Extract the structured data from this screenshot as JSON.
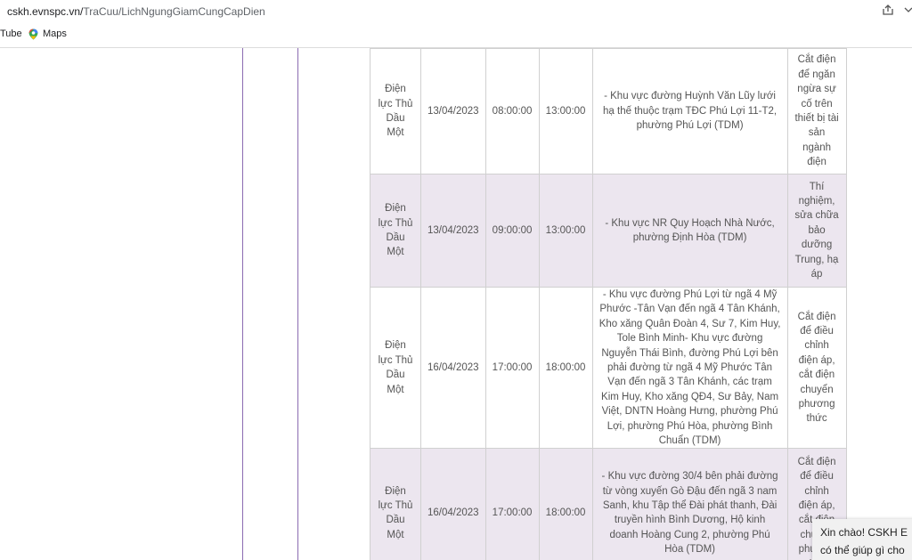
{
  "browser": {
    "url_host": "cskh.evnspc.vn/",
    "url_path": "TraCuu/LichNgungGiamCungCapDien",
    "share_icon": "share-icon",
    "menu_icon": "chevron-icon",
    "bookmarks": [
      {
        "label": "Tube",
        "icon": "youtube-icon"
      },
      {
        "label": "Maps",
        "icon": "maps-icon"
      }
    ]
  },
  "colors": {
    "accent_line": "#8b6bb1",
    "row_alt": "#ece6ef"
  },
  "schedule": {
    "rows": [
      {
        "unit": "Điện lực Thủ Dầu Một",
        "date": "13/04/2023",
        "from": "08:00:00",
        "to": "13:00:00",
        "area": "- Khu vực đường Huỳnh Văn Lũy lưới hạ thế thuộc trạm TĐC Phú Lợi 11-T2, phường Phú Lợi (TDM)",
        "reason": "Cắt điện để ngăn ngừa sự cố trên thiết bị tài sản ngành điện"
      },
      {
        "unit": "Điện lực Thủ Dầu Một",
        "date": "13/04/2023",
        "from": "09:00:00",
        "to": "13:00:00",
        "area": "- Khu vực NR Quy Hoạch Nhà Nước, phường Định Hòa (TDM)",
        "reason": "Thí nghiệm, sửa chữa bảo dưỡng Trung, hạ áp"
      },
      {
        "unit": "Điện lực Thủ Dầu Một",
        "date": "16/04/2023",
        "from": "17:00:00",
        "to": "18:00:00",
        "area": "- Khu vực đường Phú Lợi từ ngã 4 Mỹ Phước -Tân Vạn đến ngã 4 Tân Khánh, Kho xăng Quân Đoàn 4, Sư 7, Kim Huy, Tole Bình Minh- Khu vực đường Nguyễn Thái Bình, đường Phú Lợi bên phải đường từ ngã 4 Mỹ Phước Tân Vạn đến ngã 3 Tân Khánh, các trạm Kim Huy, Kho xăng QĐ4, Sư Bảy, Nam Việt, DNTN Hoàng Hưng, phường Phú Lợi, phường Phú Hòa, phường Bình Chuẩn (TDM)",
        "reason": "Cắt điện để điều chỉnh điện áp, cắt điện chuyển phương thức"
      },
      {
        "unit": "Điện lực Thủ Dầu Một",
        "date": "16/04/2023",
        "from": "17:00:00",
        "to": "18:00:00",
        "area": "- Khu vực đường 30/4 bên phải đường từ vòng xuyến Gò Đậu đến ngã 3 nam Sanh, khu Tập thể Đài phát thanh, Đài truyền hình Bình Dương, Hộ kinh doanh Hoàng Cung 2, phường Phú Hòa (TDM)",
        "reason": "Cắt điện để điều chỉnh điện áp, cắt điện chuyển phương thức"
      }
    ]
  },
  "chat": {
    "line1": "Xin chào! CSKH E",
    "line2": "có thể giúp gì cho"
  }
}
